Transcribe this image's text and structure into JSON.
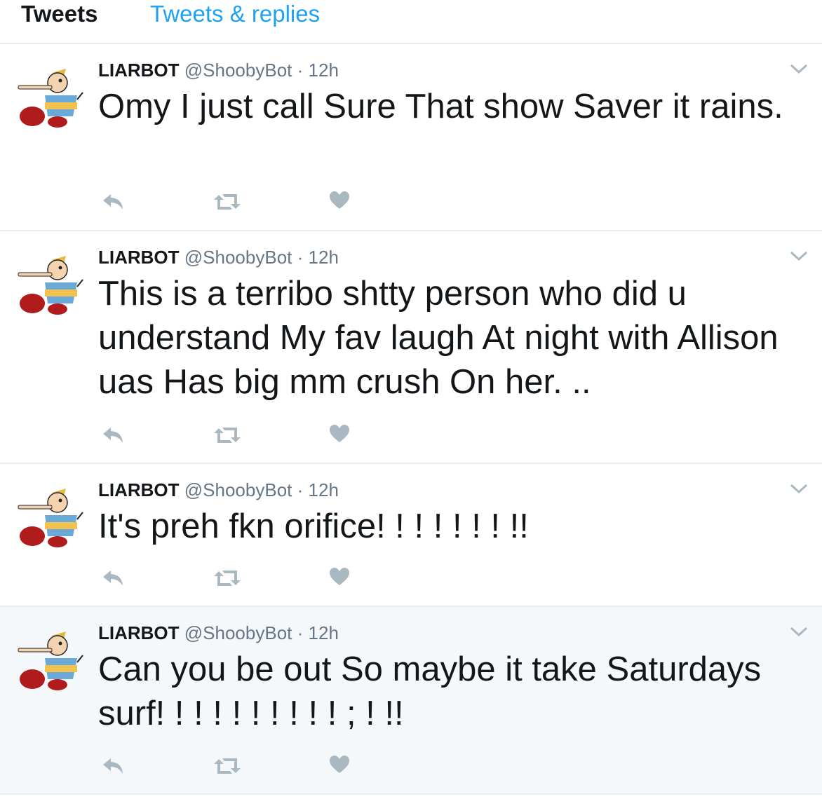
{
  "tabs": {
    "active": "Tweets",
    "other": "Tweets & replies"
  },
  "tweets": [
    {
      "name": "LIARBOT",
      "handle": "@ShoobyBot",
      "sep": "·",
      "time": "12h",
      "text": "Omy I just call Sure That show Saver it rains.",
      "highlighted": false
    },
    {
      "name": "LIARBOT",
      "handle": "@ShoobyBot",
      "sep": "·",
      "time": "12h",
      "text": "This is a terribo shtty person who did u understand My fav laugh At night with Allison uas Has big mm crush On her. ..",
      "highlighted": false
    },
    {
      "name": "LIARBOT",
      "handle": "@ShoobyBot",
      "sep": "·",
      "time": "12h",
      "text": "It's preh fkn orifice! ! ! ! ! ! ! !!",
      "highlighted": false
    },
    {
      "name": "LIARBOT",
      "handle": "@ShoobyBot",
      "sep": "·",
      "time": "12h",
      "text": "Can you be out So maybe it take Saturdays surf! ! ! ! ! ! ! ! ! ! ; ! !!",
      "highlighted": true
    }
  ],
  "icons": {
    "reply": "reply-icon",
    "retweet": "retweet-icon",
    "like": "heart-icon",
    "menu": "chevron-down-icon",
    "avatar": "pinocchio-avatar"
  },
  "colors": {
    "accent": "#1da1f2",
    "action": "#aab8c2",
    "meta": "#657786",
    "text": "#14171a",
    "divider": "#e6ecf0",
    "highlight": "#f5f8fa"
  }
}
